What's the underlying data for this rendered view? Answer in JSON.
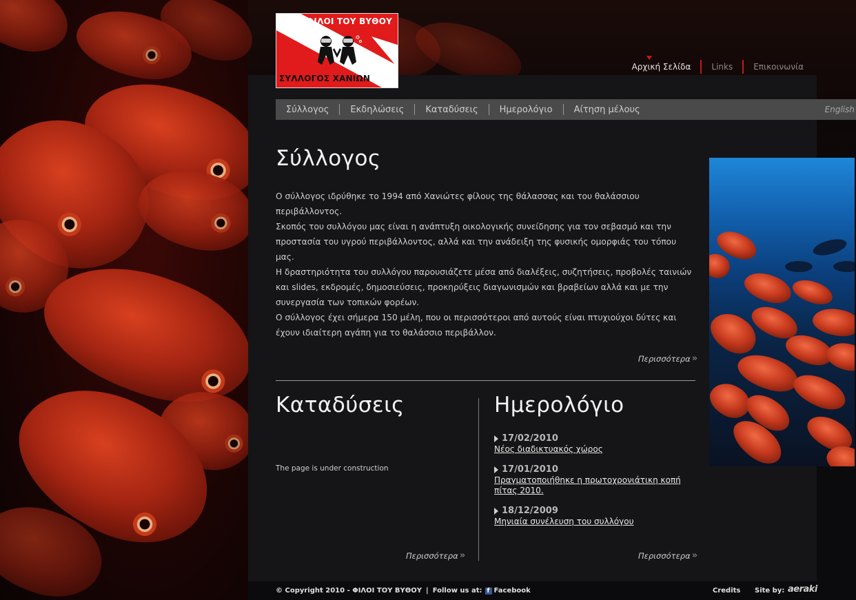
{
  "logo": {
    "top_text": "ΦΙΛΟΙ ΤΟΥ ΒΥΘΟΥ",
    "bottom_text": "ΣΥΛΛΟΓΟΣ ΧΑΝΙΩΝ"
  },
  "top_links": {
    "home": "Αρχική Σελίδα",
    "links": "Links",
    "contact": "Επικοινωνία"
  },
  "nav": {
    "items": [
      "Σύλλογος",
      "Εκδηλώσεις",
      "Καταδύσεις",
      "Ημερολόγιο",
      "Αίτηση μέλους"
    ],
    "language": "English"
  },
  "main": {
    "title": "Σύλλογος",
    "paragraphs": [
      "Ο σύλλογος ιδρύθηκε το 1994 από Χανιώτες φίλους της θάλασσας και του θαλάσσιου περιβάλλοντος.",
      "Σκοπός του συλλόγου μας είναι η ανάπτυξη οικολογικής συνείδησης για τον σεβασμό και την προστασία του υγρού περιβάλλοντος, αλλά και την ανάδειξη της φυσικής ομορφιάς του τόπου μας.",
      "Η δραστηριότητα του συλλόγου παρουσιάζετε μέσα από διαλέξεις, συζητήσεις, προβολές ταινιών και slides, εκδρομές, δημοσιεύσεις, προκηρύξεις διαγωνισμών και βραβείων αλλά και με την συνεργασία των τοπικών φορέων.",
      "Ο σύλλογος έχει σήμερα 150 μέλη, που οι περισσότεροι από αυτούς είναι πτυχιούχοι δύτες και έχουν ιδιαίτερη αγάπη για το θαλάσσιο περιβάλλον."
    ],
    "more": "Περισσότερα"
  },
  "dives": {
    "title": "Καταδύσεις",
    "text": "The page is under construction",
    "more": "Περισσότερα"
  },
  "calendar": {
    "title": "Ημερολόγιο",
    "events": [
      {
        "date": "17/02/2010",
        "title": "Νέος διαδικτυακός χώρος"
      },
      {
        "date": "17/01/2010",
        "title": "Πραγματοποιήθηκε η πρωτοχρονιάτικη κοπή πίτας 2010."
      },
      {
        "date": "18/12/2009",
        "title": "Μηνιαία συνέλευση του συλλόγου"
      }
    ],
    "more": "Περισσότερα"
  },
  "footer": {
    "copyright": "© Copyright 2010 - ΦΙΛΟΙ ΤΟΥ ΒΥΘΟΥ",
    "separator": "|",
    "follow": "Follow us at:",
    "facebook": "Facebook",
    "credits": "Credits",
    "site_by": "Site by:",
    "brand": "aeraki"
  },
  "colors": {
    "accent_red": "#c21b1b",
    "panel": "#151517",
    "navbar": "#4a4a4a"
  }
}
